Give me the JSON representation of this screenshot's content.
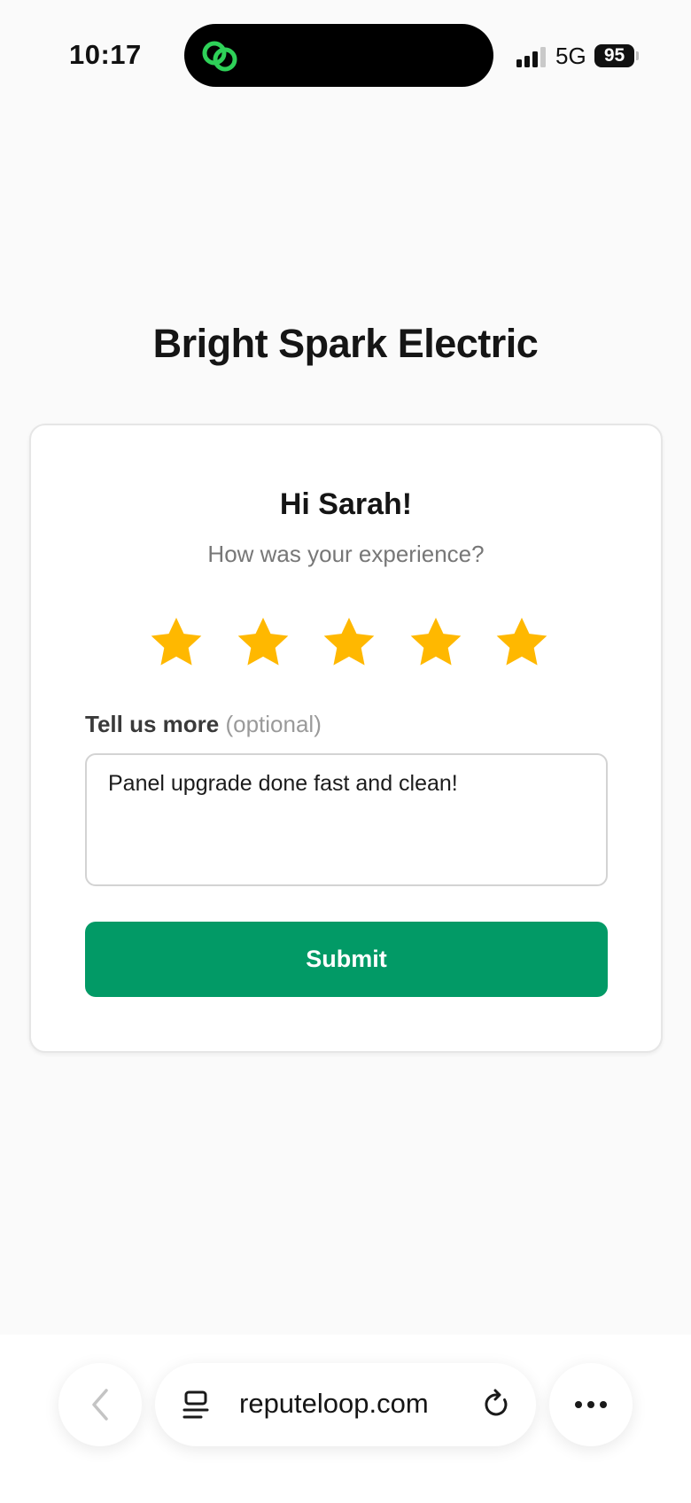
{
  "status_bar": {
    "time": "10:17",
    "network": "5G",
    "battery": "95",
    "island_app_icon": "link-loop-icon",
    "island_app_color": "#2ed158"
  },
  "header": {
    "business_name": "Bright Spark Electric"
  },
  "card": {
    "greeting": "Hi Sarah!",
    "question": "How was your experience?",
    "rating": {
      "value": 5,
      "max": 5,
      "star_color": "#ffb800"
    },
    "comment": {
      "label": "Tell us more",
      "optional": "(optional)",
      "value": "Panel upgrade done fast and clean!"
    },
    "submit_label": "Submit",
    "accent_color": "#029a66"
  },
  "browser": {
    "url": "reputeloop.com",
    "icons": {
      "back": "chevron-left-icon",
      "tabs": "tabs-icon",
      "reload": "reload-icon",
      "more": "more-dots-icon"
    }
  }
}
